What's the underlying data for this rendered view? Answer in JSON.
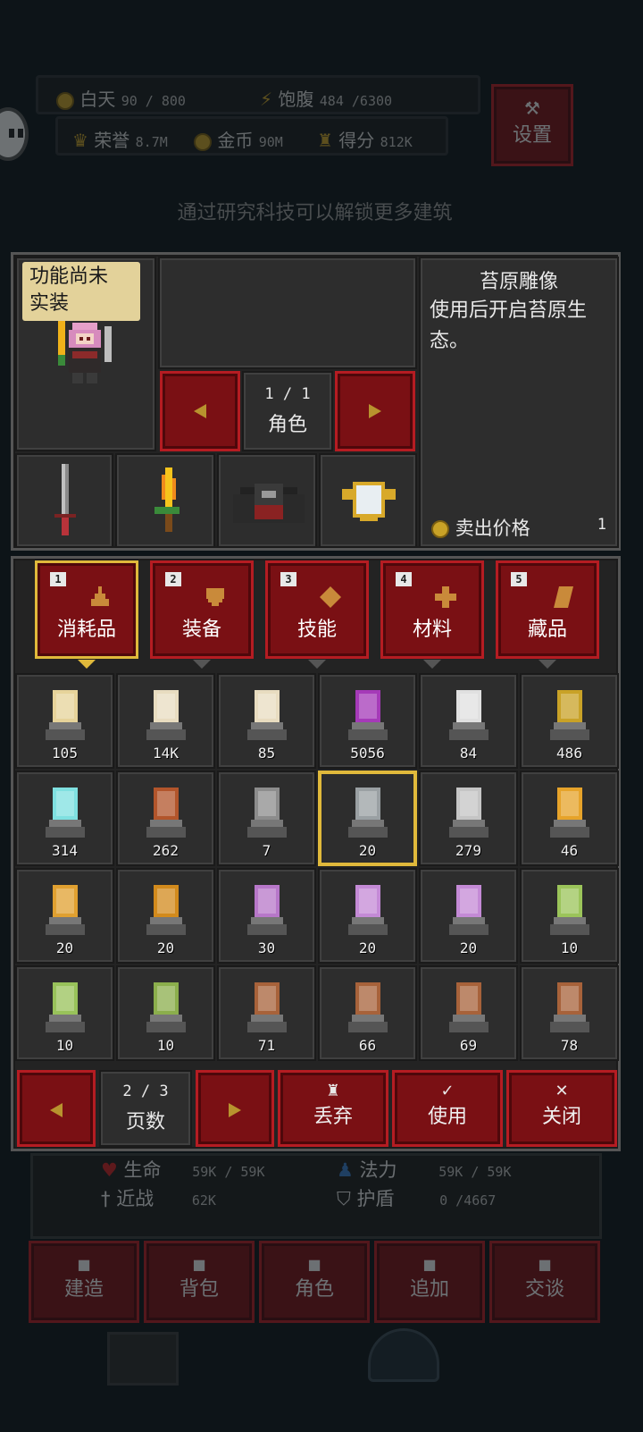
{
  "hud": {
    "day_label": "白天",
    "day_value": "90 / 800",
    "food_label": "饱腹",
    "food_value": "484 /6300",
    "honor_label": "荣誉",
    "honor_value": "8.7M",
    "gold_label": "金币",
    "gold_value": "90M",
    "score_label": "得分",
    "score_value": "812K",
    "settings_label": "设置"
  },
  "hint": "通过研究科技可以解锁更多建筑",
  "character": {
    "tooltip": "功能尚未\n实装",
    "page": "1 / 1",
    "page_label": "角色"
  },
  "item_info": {
    "title": "苔原雕像",
    "description": "使用后开启苔原生态。",
    "price_label": "卖出价格",
    "price_value": "1"
  },
  "equipment_slots": [
    "sword-icon",
    "flame-sword-icon",
    "cape-armor-icon",
    "shield-emblem-icon"
  ],
  "tabs": [
    {
      "num": "1",
      "label": "消耗品",
      "icon": "flask-icon",
      "active": true
    },
    {
      "num": "2",
      "label": "装备",
      "icon": "shield-icon",
      "active": false
    },
    {
      "num": "3",
      "label": "技能",
      "icon": "diamond-icon",
      "active": false
    },
    {
      "num": "4",
      "label": "材料",
      "icon": "cross-icon",
      "active": false
    },
    {
      "num": "5",
      "label": "藏品",
      "icon": "leaf-icon",
      "active": false
    }
  ],
  "items": [
    {
      "icon": "eye-orb-icon",
      "count": "105",
      "color": "#e6d39a"
    },
    {
      "icon": "scroll-house-icon",
      "count": "14K",
      "color": "#e8dcc0"
    },
    {
      "icon": "scroll-orb-icon",
      "count": "85",
      "color": "#e8dcc0"
    },
    {
      "icon": "potion-icon",
      "count": "5056",
      "color": "#a53ab8"
    },
    {
      "icon": "winged-statue-icon",
      "count": "84",
      "color": "#e0e0e0"
    },
    {
      "icon": "gem-statue-icon",
      "count": "486",
      "color": "#c9a227"
    },
    {
      "icon": "crystal-statue-icon",
      "count": "314",
      "color": "#7fe0e0"
    },
    {
      "icon": "mushroom-statue-icon",
      "count": "262",
      "color": "#b2552b"
    },
    {
      "icon": "bat-statue-icon",
      "count": "7",
      "color": "#8c8c8c"
    },
    {
      "icon": "tundra-statue-icon",
      "count": "20",
      "color": "#9aa0a3"
    },
    {
      "icon": "target-icon",
      "count": "279",
      "color": "#c5c5c5"
    },
    {
      "icon": "amber-card-icon",
      "count": "46",
      "color": "#e6a32a"
    },
    {
      "icon": "cross-hex-icon",
      "count": "20",
      "color": "#e0a030"
    },
    {
      "icon": "shield-badge-icon",
      "count": "20",
      "color": "#d28a1c"
    },
    {
      "icon": "purple-card-icon",
      "count": "30",
      "color": "#b777c9"
    },
    {
      "icon": "purple-cross-icon",
      "count": "20",
      "color": "#c48ad6"
    },
    {
      "icon": "purple-shield-icon",
      "count": "20",
      "color": "#c48ad6"
    },
    {
      "icon": "green-gem-shield-icon",
      "count": "10",
      "color": "#9bc45a"
    },
    {
      "icon": "green-cross-icon",
      "count": "10",
      "color": "#98c25a"
    },
    {
      "icon": "skull-badge-icon",
      "count": "10",
      "color": "#8bae4c"
    },
    {
      "icon": "map-house-icon",
      "count": "71",
      "color": "#a7623a"
    },
    {
      "icon": "map-mountain-icon",
      "count": "66",
      "color": "#a7623a"
    },
    {
      "icon": "map-sun-icon",
      "count": "69",
      "color": "#a7623a"
    },
    {
      "icon": "map-fish-icon",
      "count": "78",
      "color": "#a7623a"
    }
  ],
  "bottom_bar": {
    "page": "2 / 3",
    "page_label": "页数",
    "discard": "丢弃",
    "use": "使用",
    "close": "关闭"
  },
  "stats": {
    "hp_label": "生命",
    "hp_value": "59K / 59K",
    "mp_label": "法力",
    "mp_value": "59K / 59K",
    "melee_label": "近战",
    "melee_value": "62K",
    "shield_label": "护盾",
    "shield_value": "0 /4667"
  },
  "menu": [
    "建造",
    "背包",
    "角色",
    "追加",
    "交谈"
  ]
}
